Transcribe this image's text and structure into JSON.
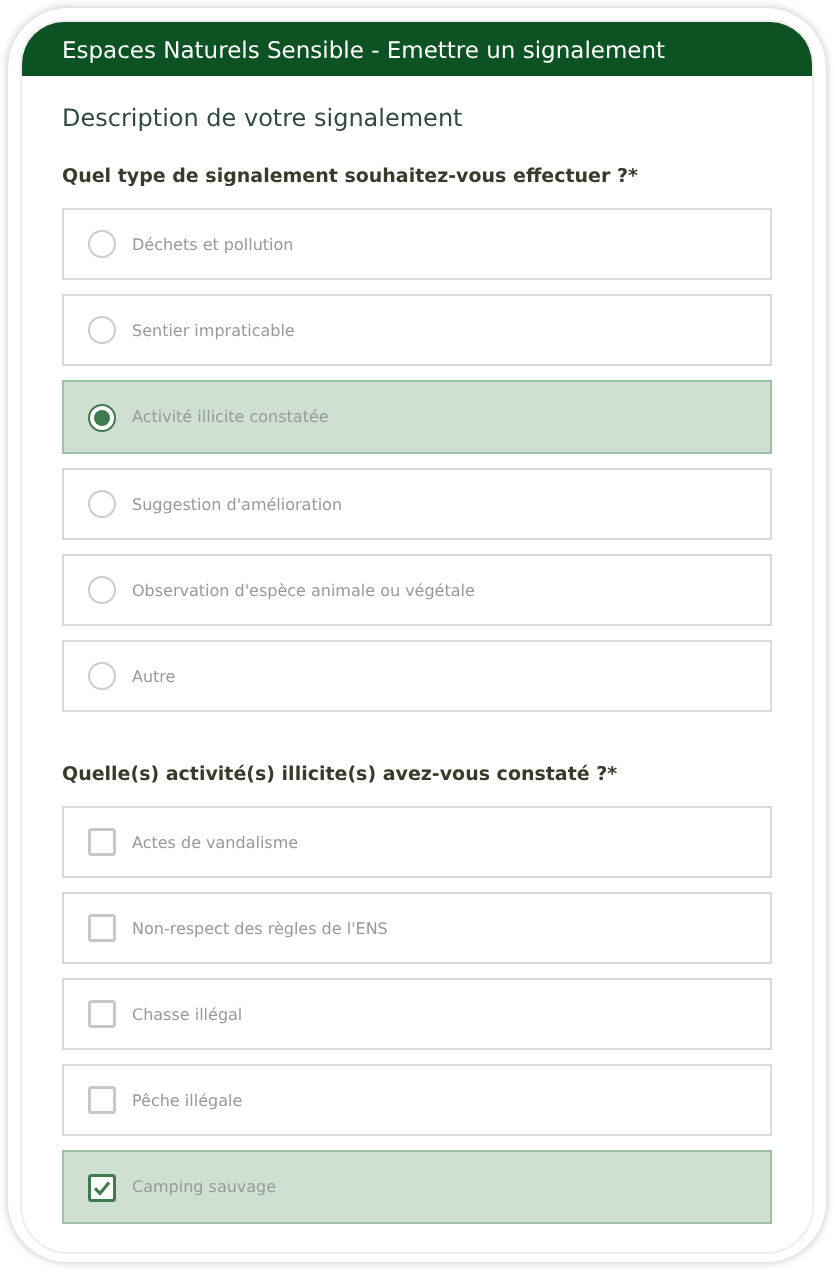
{
  "header": {
    "title": "Espaces Naturels Sensible - Emettre un signalement"
  },
  "section_title": "Description de votre signalement",
  "questions": [
    {
      "kind": "radio",
      "label": "Quel type de signalement souhaitez-vous effectuer ?*",
      "options": [
        {
          "label": "Déchets et pollution",
          "selected": false
        },
        {
          "label": "Sentier impraticable",
          "selected": false
        },
        {
          "label": "Activité illicite constatée",
          "selected": true
        },
        {
          "label": "Suggestion d'amélioration",
          "selected": false
        },
        {
          "label": "Observation d'espèce animale ou végétale",
          "selected": false
        },
        {
          "label": "Autre",
          "selected": false
        }
      ]
    },
    {
      "kind": "checkbox",
      "label": "Quelle(s) activité(s) illicite(s) avez-vous constaté ?*",
      "options": [
        {
          "label": "Actes de vandalisme",
          "checked": false
        },
        {
          "label": "Non-respect des règles de l'ENS",
          "checked": false
        },
        {
          "label": "Chasse illégal",
          "checked": false
        },
        {
          "label": "Pêche illégale",
          "checked": false
        },
        {
          "label": "Camping sauvage",
          "checked": true
        }
      ]
    }
  ]
}
